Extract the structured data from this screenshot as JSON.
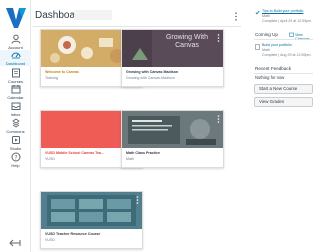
{
  "nav": {
    "items": [
      {
        "label": "Account",
        "icon": "account-icon"
      },
      {
        "label": "Dashboard",
        "icon": "dashboard-icon"
      },
      {
        "label": "Courses",
        "icon": "courses-icon"
      },
      {
        "label": "Calendar",
        "icon": "calendar-icon"
      },
      {
        "label": "Inbox",
        "icon": "inbox-icon"
      },
      {
        "label": "Commons",
        "icon": "commons-icon"
      },
      {
        "label": "Studio",
        "icon": "studio-icon"
      },
      {
        "label": "Help",
        "icon": "help-icon"
      }
    ],
    "accent": "#0770a3"
  },
  "header": {
    "title": "Dashboard"
  },
  "cards": [
    {
      "name": "Welcome to Canvas",
      "sub": "Training",
      "color": "#d6b36f",
      "name_color": "#c2830a"
    },
    {
      "name": "Growing with Canvas Madison",
      "sub": "Growing with Canvas-Madison",
      "color": "#4a3f4a",
      "name_color": "#2d3b45",
      "hero_text": "Growing With Canvas"
    },
    {
      "name": "VUSD Middle School Canvas Tea...",
      "sub": "VUSD",
      "color": "#ee5c55",
      "name_color": "#e0403b"
    },
    {
      "name": "Math Class Practice",
      "sub": "Math",
      "color": "#5a6a6e",
      "name_color": "#2d3b45"
    },
    {
      "name": "VUSD Teacher Resource Course",
      "sub": "VUSD",
      "color": "#4f7e8c",
      "name_color": "#2d3b45"
    }
  ],
  "todo": {
    "item_title": "Tips to Build your portfolio",
    "item_course": "Math",
    "item_due": "Complete | April 29 at 12:59pm"
  },
  "coming_up": {
    "title": "Coming Up",
    "view_calendar": "View Calendar",
    "item_title": "Build your portfolio",
    "item_course": "Math",
    "item_due": "Complete | Aug 29 at 12:59pm"
  },
  "feedback": {
    "title": "Recent Feedback",
    "empty": "Nothing for now"
  },
  "buttons": {
    "start_course": "Start a New Course",
    "view_grades": "View Grades"
  }
}
